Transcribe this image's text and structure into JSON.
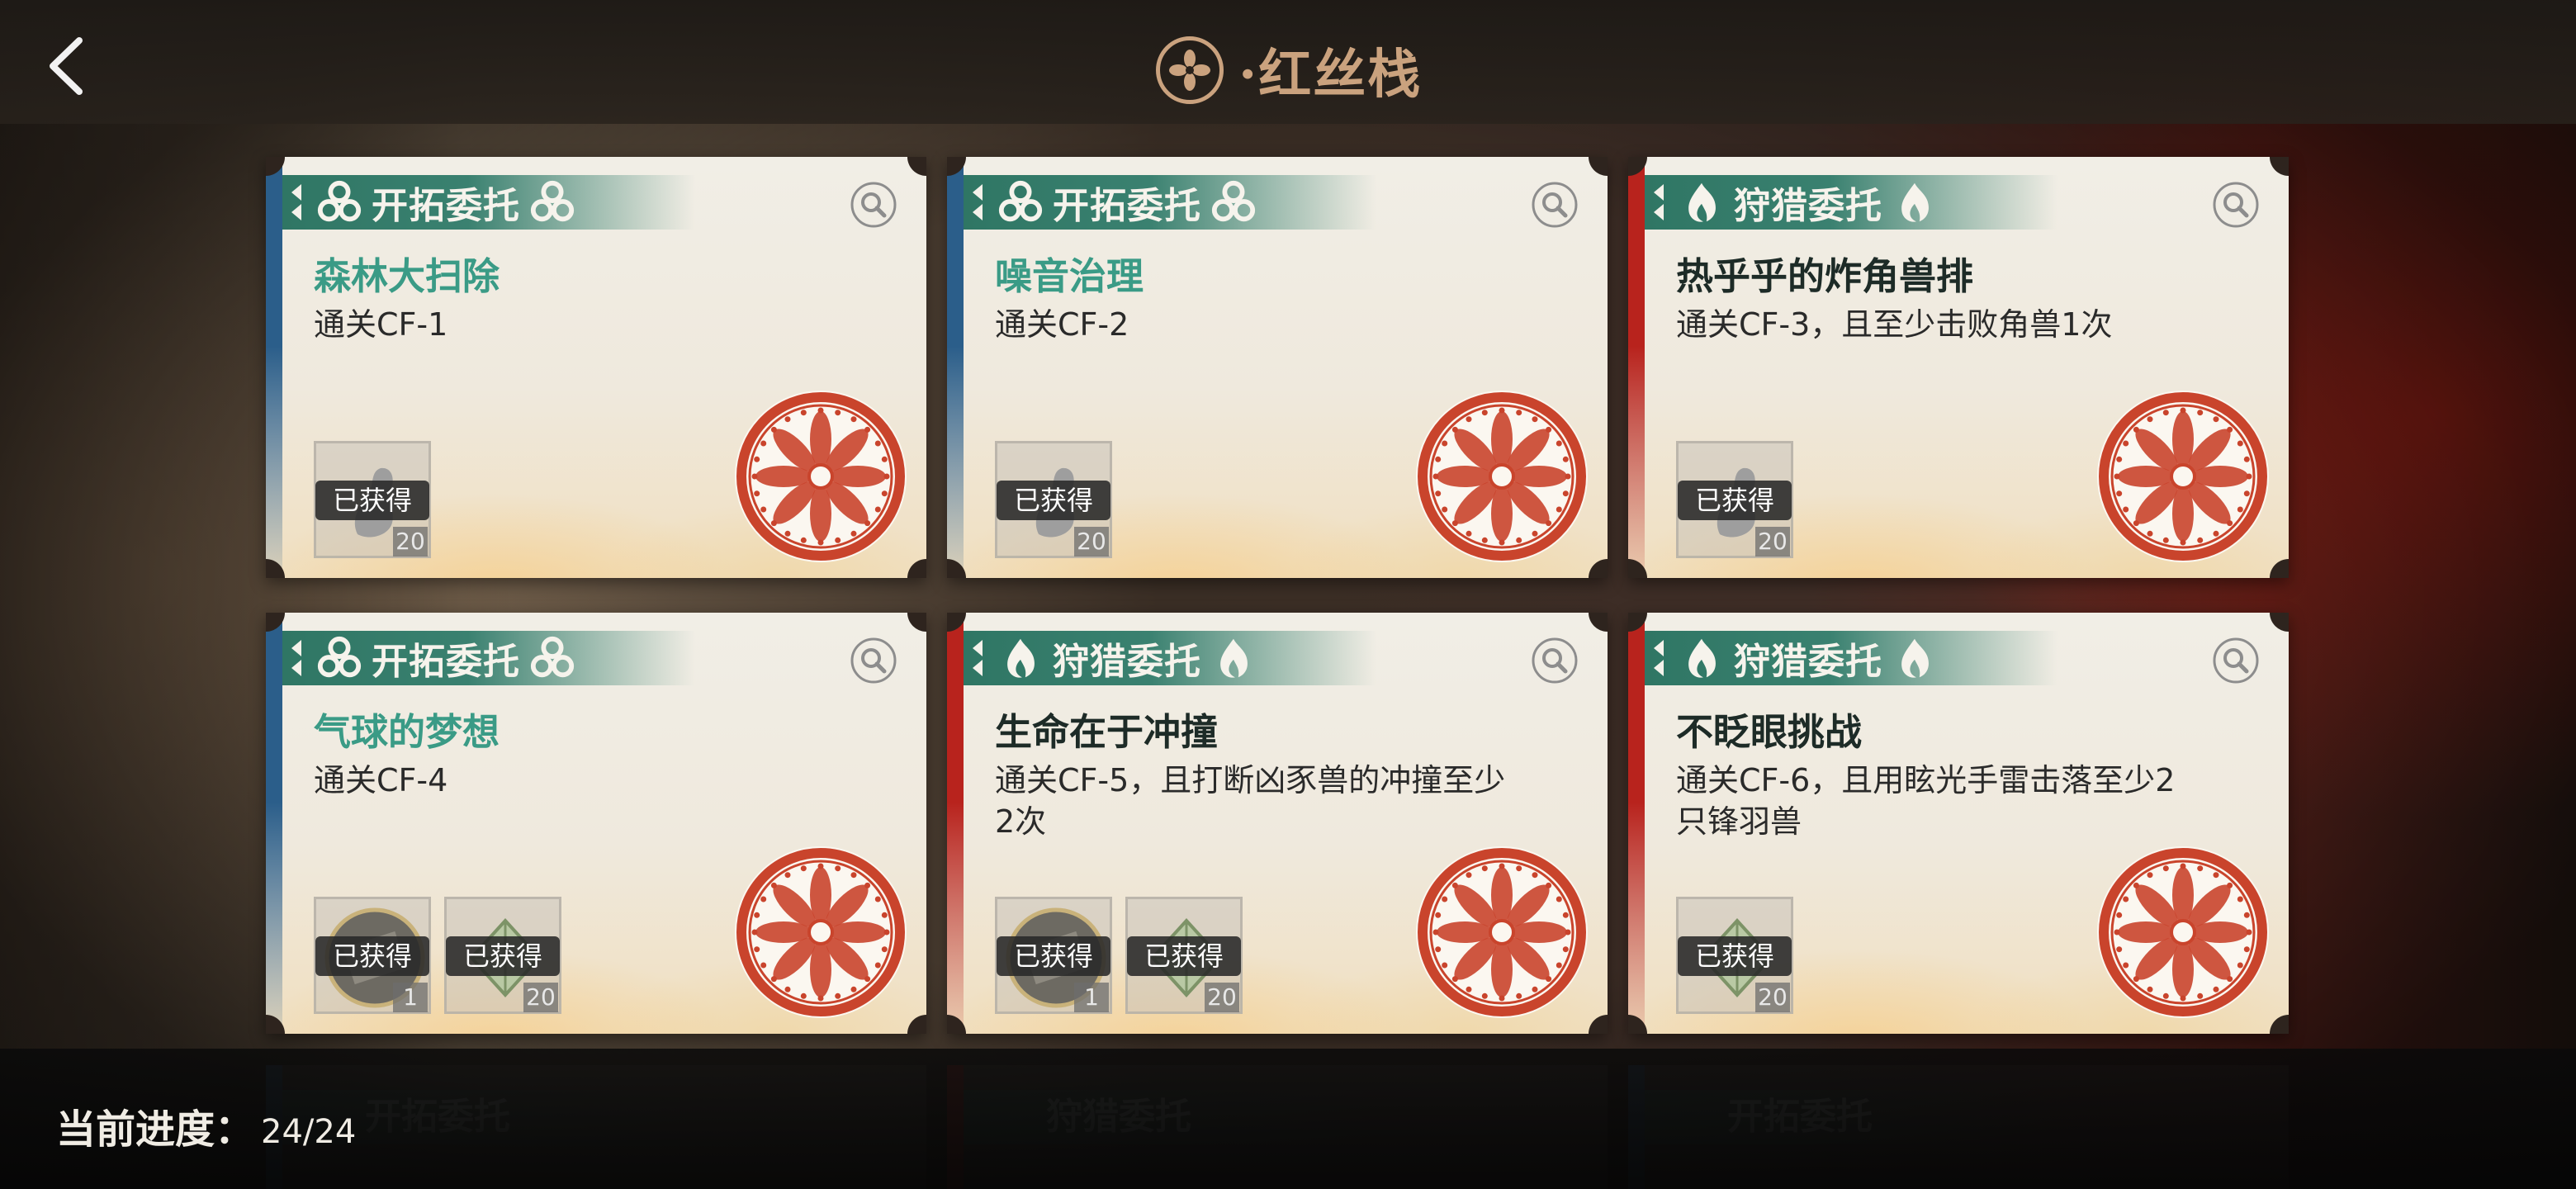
{
  "header": {
    "title": "·红丝栈"
  },
  "cards": [
    {
      "type_label": "开拓委托",
      "type": "pioneer",
      "title": "森林大扫除",
      "desc": "通关CF-1",
      "rewards": [
        {
          "tag": "已获得",
          "count": "20",
          "item": "material-icon"
        }
      ]
    },
    {
      "type_label": "开拓委托",
      "type": "pioneer",
      "title": "噪音治理",
      "desc": "通关CF-2",
      "rewards": [
        {
          "tag": "已获得",
          "count": "20",
          "item": "material-icon"
        }
      ]
    },
    {
      "type_label": "狩猎委托",
      "type": "hunt",
      "title": "热乎乎的炸角兽排",
      "desc": "通关CF-3，且至少击败角兽1次",
      "rewards": [
        {
          "tag": "已获得",
          "count": "20",
          "item": "material-icon"
        }
      ]
    },
    {
      "type_label": "开拓委托",
      "type": "pioneer",
      "title": "气球的梦想",
      "desc": "通关CF-4",
      "rewards": [
        {
          "tag": "已获得",
          "count": "1",
          "item": "coin-icon"
        },
        {
          "tag": "已获得",
          "count": "20",
          "item": "crystal-icon"
        }
      ]
    },
    {
      "type_label": "狩猎委托",
      "type": "hunt",
      "title": "生命在于冲撞",
      "desc": "通关CF-5，且打断凶豕兽的冲撞至少2次",
      "rewards": [
        {
          "tag": "已获得",
          "count": "1",
          "item": "coin-icon"
        },
        {
          "tag": "已获得",
          "count": "20",
          "item": "crystal-icon"
        }
      ]
    },
    {
      "type_label": "狩猎委托",
      "type": "hunt",
      "title": "不眨眼挑战",
      "desc": "通关CF-6，且用眩光手雷击落至少2只锋羽兽",
      "rewards": [
        {
          "tag": "已获得",
          "count": "20",
          "item": "crystal-icon"
        }
      ]
    }
  ],
  "ghost_cards": [
    {
      "type_label": "开拓委托"
    },
    {
      "type_label": "狩猎委托"
    },
    {
      "type_label": "开拓委托"
    }
  ],
  "progress": {
    "label": "当前进度：",
    "value": "24/24"
  },
  "colors": {
    "pioneer": "#2b5e8a",
    "hunt": "#b8231d",
    "banner": "#2f7664",
    "stamp": "#c9442c"
  }
}
